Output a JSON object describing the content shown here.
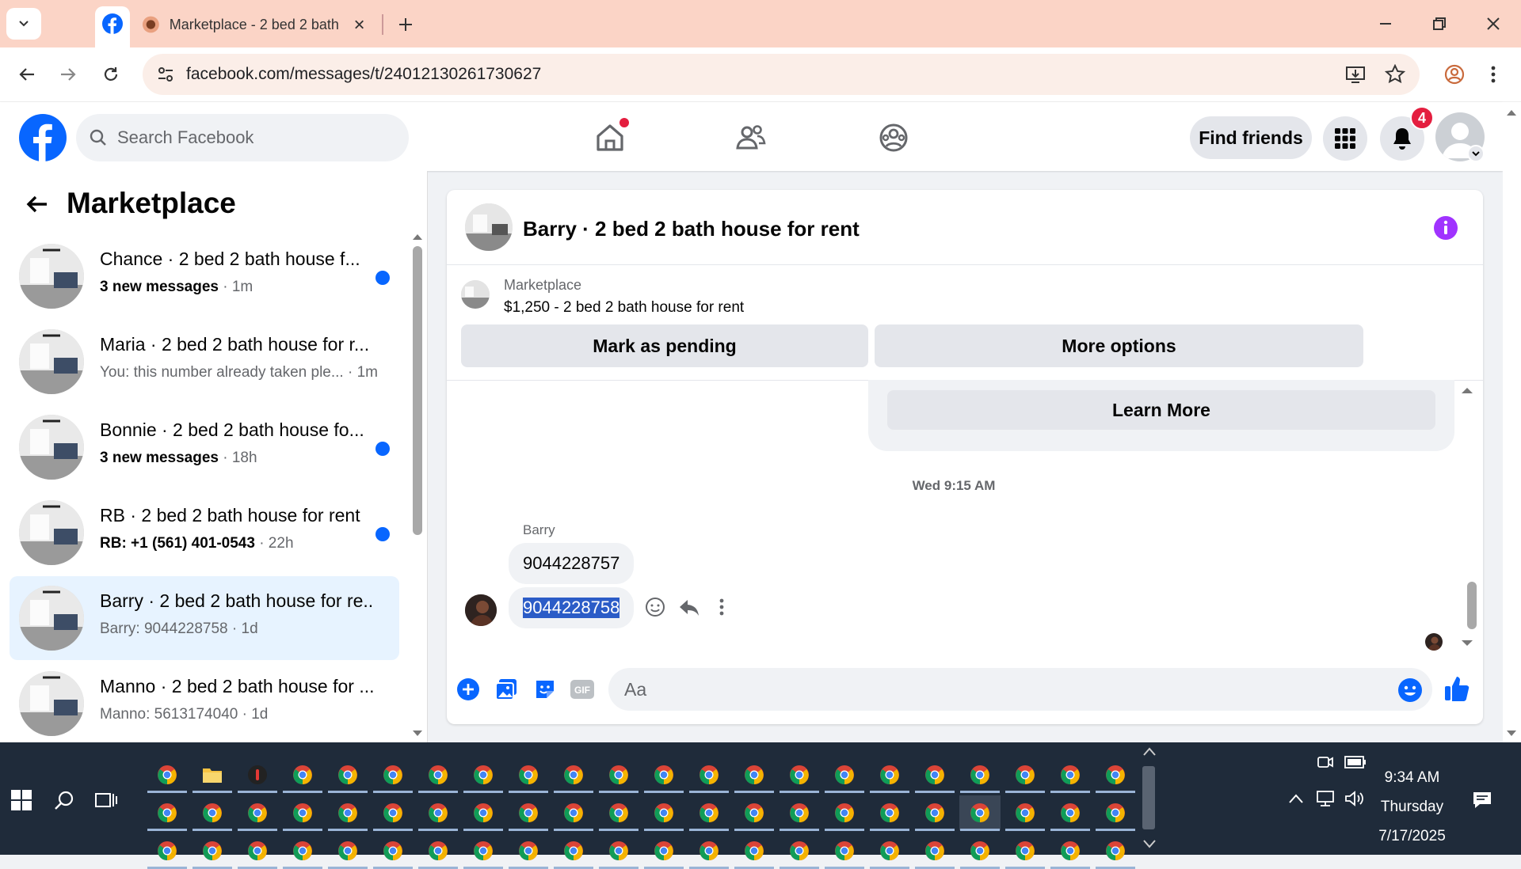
{
  "browser": {
    "tab_title": "Marketplace - 2 bed 2 bath house for rent",
    "url": "facebook.com/messages/t/24012130261730627"
  },
  "header": {
    "search_placeholder": "Search Facebook",
    "find_friends": "Find friends",
    "notification_count": "4"
  },
  "sidebar": {
    "title": "Marketplace",
    "conversations": [
      {
        "name": "Chance · 2 bed 2 bath house f...",
        "bold": "3 new messages",
        "meta": " · 1m",
        "unread": true
      },
      {
        "name": "Maria · 2 bed 2 bath house for r...",
        "bold": "",
        "meta": "You: this number already taken ple... · 1m",
        "unread": false
      },
      {
        "name": "Bonnie · 2 bed 2 bath house fo...",
        "bold": "3 new messages",
        "meta": " · 18h",
        "unread": true
      },
      {
        "name": "RB · 2 bed 2 bath house for rent",
        "bold": "RB: +1 (561) 401-0543",
        "meta": " · 22h",
        "unread": true
      },
      {
        "name": "Barry · 2 bed 2 bath house for re...",
        "bold": "",
        "meta": "Barry: 9044228758 · 1d",
        "unread": false
      },
      {
        "name": "Manno · 2 bed 2 bath house for ...",
        "bold": "",
        "meta": "Manno: 5613174040 · 1d",
        "unread": false
      }
    ]
  },
  "chat": {
    "title": "Barry · 2 bed 2 bath house for rent",
    "listing_source": "Marketplace",
    "listing_text": "$1,250 - 2 bed 2 bath house for rent",
    "mark_pending": "Mark as pending",
    "more_options": "More options",
    "learn_more": "Learn More",
    "timestamp": "Wed 9:15 AM",
    "sender": "Barry",
    "messages": [
      "9044228757",
      "9044228758"
    ],
    "input_placeholder": "Aa"
  },
  "taskbar": {
    "time": "9:34 AM",
    "day": "Thursday",
    "date": "7/17/2025"
  },
  "colors": {
    "accent": "#0866ff",
    "tab_bar": "#fbd4c6",
    "selected_conv": "#e7f3ff",
    "info_purple": "#a033ff",
    "taskbar": "#1f2b3a"
  }
}
